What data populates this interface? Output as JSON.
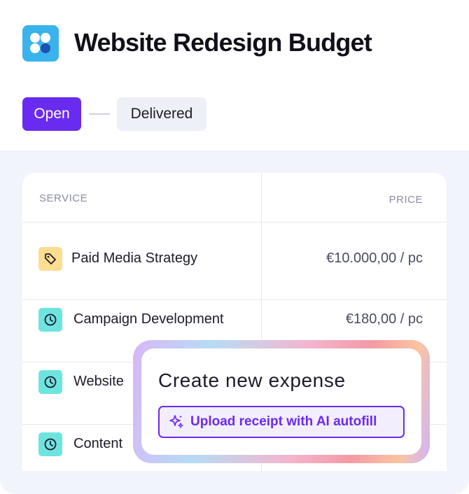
{
  "header": {
    "title": "Website Redesign Budget",
    "logo_icon": "app-logo-icon"
  },
  "status": {
    "current": "Open",
    "next": "Delivered",
    "current_color": "#6a2bf0"
  },
  "table": {
    "columns": {
      "service": "SERVICE",
      "price": "PRICE"
    },
    "rows": [
      {
        "icon": "tag-icon",
        "name": "Paid Media Strategy",
        "price": "€10.000,00 / pc"
      },
      {
        "icon": "clock-icon",
        "name": "Campaign Development",
        "price": "€180,00 / pc"
      },
      {
        "icon": "clock-icon",
        "name": "Website",
        "price": ""
      },
      {
        "icon": "clock-icon",
        "name": "Content",
        "price": ""
      }
    ]
  },
  "popup": {
    "title": "Create new expense",
    "upload_button": "Upload receipt with AI autofill",
    "upload_icon": "sparkle-icon",
    "accent": "#6a2bf0"
  }
}
